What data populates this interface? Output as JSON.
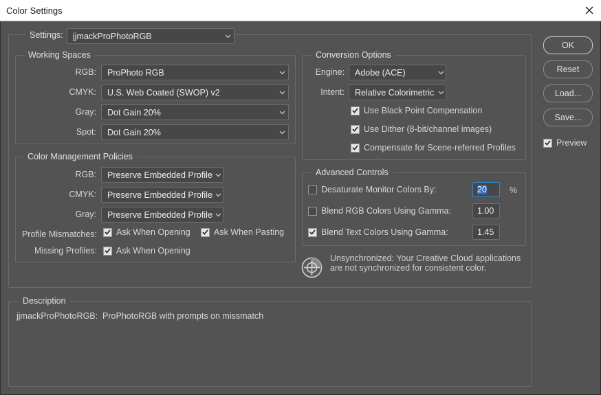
{
  "window": {
    "title": "Color Settings"
  },
  "settings": {
    "label": "Settings:",
    "value": "jjmackProPhotoRGB"
  },
  "working_spaces": {
    "legend": "Working Spaces",
    "rgb": {
      "label": "RGB:",
      "value": "ProPhoto RGB"
    },
    "cmyk": {
      "label": "CMYK:",
      "value": "U.S. Web Coated (SWOP) v2"
    },
    "gray": {
      "label": "Gray:",
      "value": "Dot Gain 20%"
    },
    "spot": {
      "label": "Spot:",
      "value": "Dot Gain 20%"
    }
  },
  "policies": {
    "legend": "Color Management Policies",
    "rgb": {
      "label": "RGB:",
      "value": "Preserve Embedded Profiles"
    },
    "cmyk": {
      "label": "CMYK:",
      "value": "Preserve Embedded Profiles"
    },
    "gray": {
      "label": "Gray:",
      "value": "Preserve Embedded Profiles"
    },
    "profile_mismatches_label": "Profile Mismatches:",
    "ask_when_opening": {
      "label": "Ask When Opening",
      "checked": true
    },
    "ask_when_pasting": {
      "label": "Ask When Pasting",
      "checked": true
    },
    "missing_profiles_label": "Missing Profiles:",
    "missing_ask_when_opening": {
      "label": "Ask When Opening",
      "checked": true
    }
  },
  "conversion": {
    "legend": "Conversion Options",
    "engine": {
      "label": "Engine:",
      "value": "Adobe (ACE)"
    },
    "intent": {
      "label": "Intent:",
      "value": "Relative Colorimetric"
    },
    "black_point": {
      "label": "Use Black Point Compensation",
      "checked": true
    },
    "dither": {
      "label": "Use Dither (8-bit/channel images)",
      "checked": true
    },
    "scene_referred": {
      "label": "Compensate for Scene-referred Profiles",
      "checked": true
    }
  },
  "advanced": {
    "legend": "Advanced Controls",
    "desaturate": {
      "label": "Desaturate Monitor Colors By:",
      "value": "20",
      "unit": "%",
      "checked": false
    },
    "blend_rgb": {
      "label": "Blend RGB Colors Using Gamma:",
      "value": "1.00",
      "checked": false
    },
    "blend_text": {
      "label": "Blend Text Colors Using Gamma:",
      "value": "1.45",
      "checked": true
    }
  },
  "sync": {
    "icon": "creative-cloud-sync-icon",
    "message_line1": "Unsynchronized: Your Creative Cloud applications",
    "message_line2": "are not synchronized for consistent color."
  },
  "description": {
    "legend": "Description",
    "text": "jjmackProPhotoRGB:  ProPhotoRGB with prompts on missmatch"
  },
  "buttons": {
    "ok": "OK",
    "reset": "Reset",
    "load": "Load...",
    "save": "Save...",
    "preview": {
      "label": "Preview",
      "checked": true
    }
  },
  "colors": {
    "background": "#535353",
    "titlebar": "#ffffff",
    "field": "#474747",
    "focus": "#2e8bd6"
  }
}
